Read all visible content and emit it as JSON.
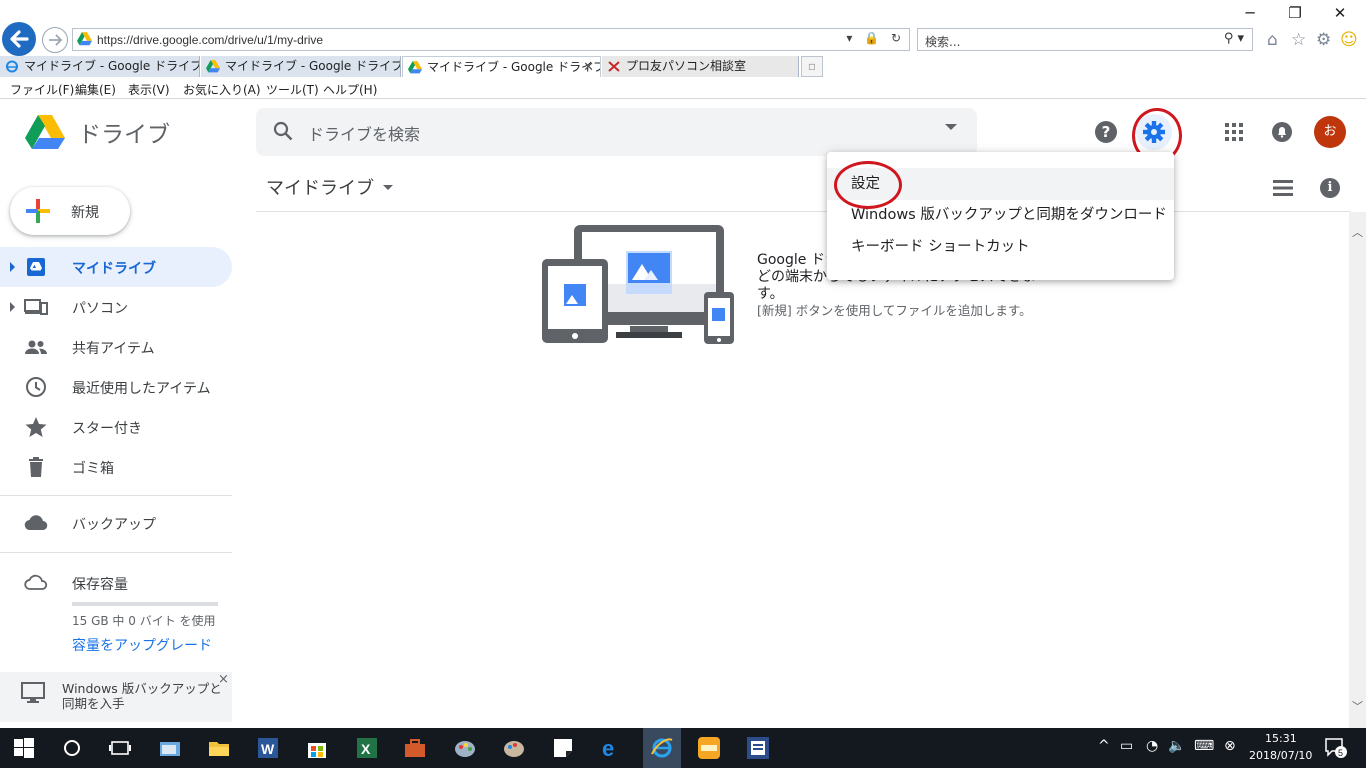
{
  "browser": {
    "address": "https://drive.google.com/drive/u/1/my-drive",
    "search_placeholder": "検索...",
    "tabs": [
      {
        "label": "マイドライブ - Google ドライブ",
        "state": "inactive"
      },
      {
        "label": "マイドライブ - Google ドライブ",
        "state": "inactive"
      },
      {
        "label": "マイドライブ - Google ドライブ",
        "state": "active"
      },
      {
        "label": "プロ友パソコン相談室",
        "state": "inactive"
      }
    ],
    "menu": [
      "ファイル(F)",
      "編集(E)",
      "表示(V)",
      "お気に入り(A)",
      "ツール(T)",
      "ヘルプ(H)"
    ],
    "window_buttons": {
      "minimize": "─",
      "restore": "❐",
      "close": "✕"
    }
  },
  "drive": {
    "app_title": "ドライブ",
    "search_placeholder": "ドライブを検索",
    "avatar_initial": "お",
    "new_button": "新規",
    "nav": [
      {
        "label": "マイドライブ",
        "icon": "my-drive-icon",
        "active": true
      },
      {
        "label": "パソコン",
        "icon": "computers-icon"
      },
      {
        "label": "共有アイテム",
        "icon": "shared-icon"
      },
      {
        "label": "最近使用したアイテム",
        "icon": "recent-icon"
      },
      {
        "label": "スター付き",
        "icon": "star-icon"
      },
      {
        "label": "ゴミ箱",
        "icon": "trash-icon"
      },
      {
        "label": "バックアップ",
        "icon": "backup-cloud-icon"
      }
    ],
    "storage": {
      "label": "保存容量",
      "usage_text": "15 GB 中 0 バイト を使用",
      "used_fraction": 0.0,
      "upgrade": "容量をアップグレード"
    },
    "promo": {
      "text": "Windows 版バックアップと同期を入手",
      "close": "×"
    },
    "breadcrumb": "マイドライブ",
    "empty_state": {
      "title": "Google ドライブにファイルを追加すると、どの端末からでもファイルにアクセスできます。",
      "subtitle": "[新規] ボタンを使用してファイルを追加します。"
    },
    "settings_menu": [
      {
        "label": "設定"
      },
      {
        "label": "Windows 版バックアップと同期をダウンロード"
      },
      {
        "label": "キーボード ショートカット"
      }
    ],
    "colors": {
      "accent": "#1a73e8",
      "active_nav_bg": "#e8f0fe",
      "annotation_red": "#d0161e",
      "avatar": "#bf360c"
    }
  },
  "taskbar": {
    "time": "15:31",
    "date": "2018/07/10",
    "notification_count": "5"
  }
}
